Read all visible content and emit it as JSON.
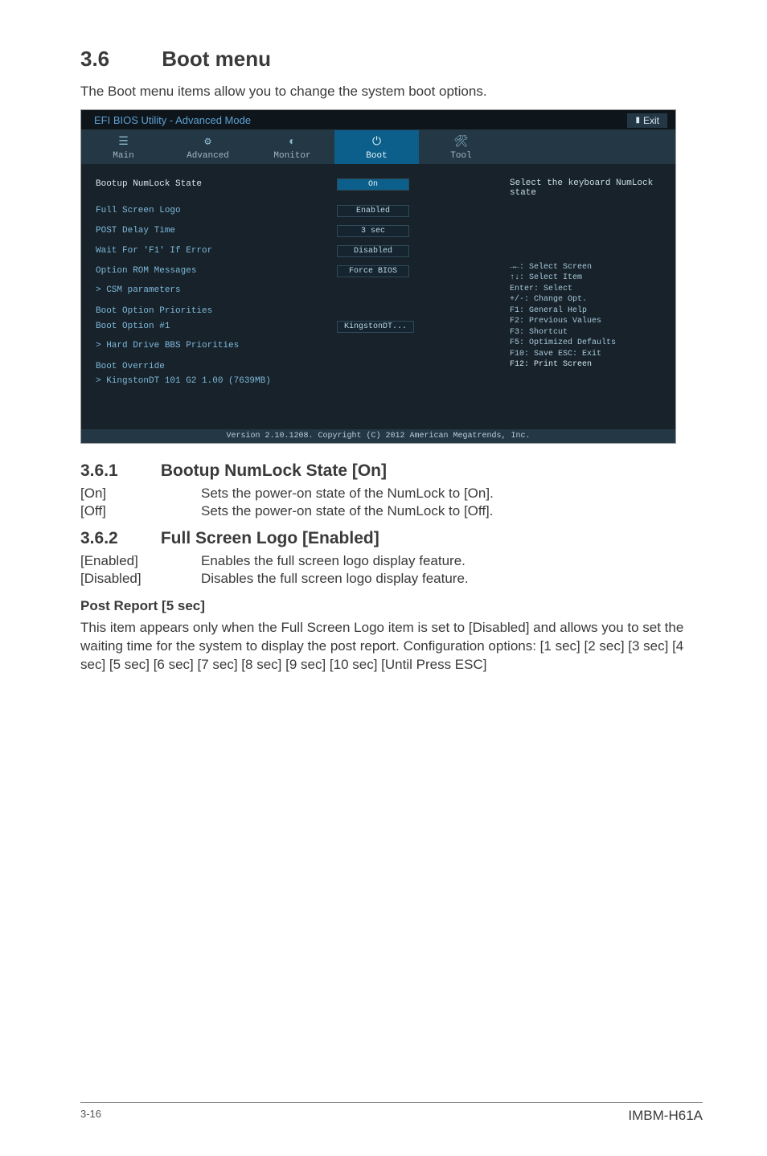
{
  "section": {
    "num": "3.6",
    "title": "Boot menu"
  },
  "intro": "The Boot menu items allow you to change the system boot options.",
  "bios": {
    "title": "EFI BIOS Utility - Advanced Mode",
    "exit": "Exit",
    "tabs": {
      "main": "Main",
      "advanced": "Advanced",
      "monitor": "Monitor",
      "boot": "Boot",
      "tool": "Tool"
    },
    "left": {
      "numlock_label": "Bootup NumLock State",
      "numlock_val": "On",
      "fullscreen_label": "Full Screen Logo",
      "fullscreen_val": "Enabled",
      "postdelay_label": "POST Delay Time",
      "postdelay_val": "3 sec",
      "waitf1_label": "Wait For 'F1' If Error",
      "waitf1_val": "Disabled",
      "optrom_label": "Option ROM Messages",
      "optrom_val": "Force BIOS",
      "csm_label": "CSM parameters",
      "boot_prio_hdr": "Boot Option Priorities",
      "boot_opt1_label": "Boot Option #1",
      "boot_opt1_val": "KingstonDT...",
      "hd_bbs": "Hard Drive BBS Priorities",
      "override_hdr": "Boot Override",
      "override_item": "KingstonDT 101 G2 1.00  (7639MB)"
    },
    "right": {
      "help": "Select the keyboard NumLock state",
      "k1": "→←: Select Screen",
      "k2": "↑↓: Select Item",
      "k3": "Enter: Select",
      "k4": "+/-: Change Opt.",
      "k5": "F1: General Help",
      "k6": "F2: Previous Values",
      "k7": "F3: Shortcut",
      "k8": "F5: Optimized Defaults",
      "k9": "F10: Save  ESC: Exit",
      "k10": "F12: Print Screen"
    },
    "footer": "Version 2.10.1208. Copyright (C) 2012 American Megatrends, Inc."
  },
  "sub361": {
    "num": "3.6.1",
    "title": "Bootup NumLock State [On]",
    "rows": [
      {
        "k": "[On]",
        "v": "Sets the power-on state of the NumLock to [On]."
      },
      {
        "k": "[Off]",
        "v": "Sets the power-on state of the NumLock to [Off]."
      }
    ]
  },
  "sub362": {
    "num": "3.6.2",
    "title": "Full Screen Logo [Enabled]",
    "rows": [
      {
        "k": "[Enabled]",
        "v": "Enables the full screen logo display feature."
      },
      {
        "k": "[Disabled]",
        "v": "Disables the full screen logo display feature."
      }
    ]
  },
  "postreport": {
    "heading": "Post Report [5 sec]",
    "body": "This item appears only when the Full Screen Logo item is set to [Disabled] and allows you to set the waiting time for the system to display the post report. Configuration options: [1 sec] [2 sec] [3 sec] [4 sec] [5 sec] [6 sec] [7 sec] [8 sec] [9 sec] [10 sec] [Until Press ESC]"
  },
  "footer": {
    "page": "3-16",
    "model": "IMBM-H61A"
  }
}
